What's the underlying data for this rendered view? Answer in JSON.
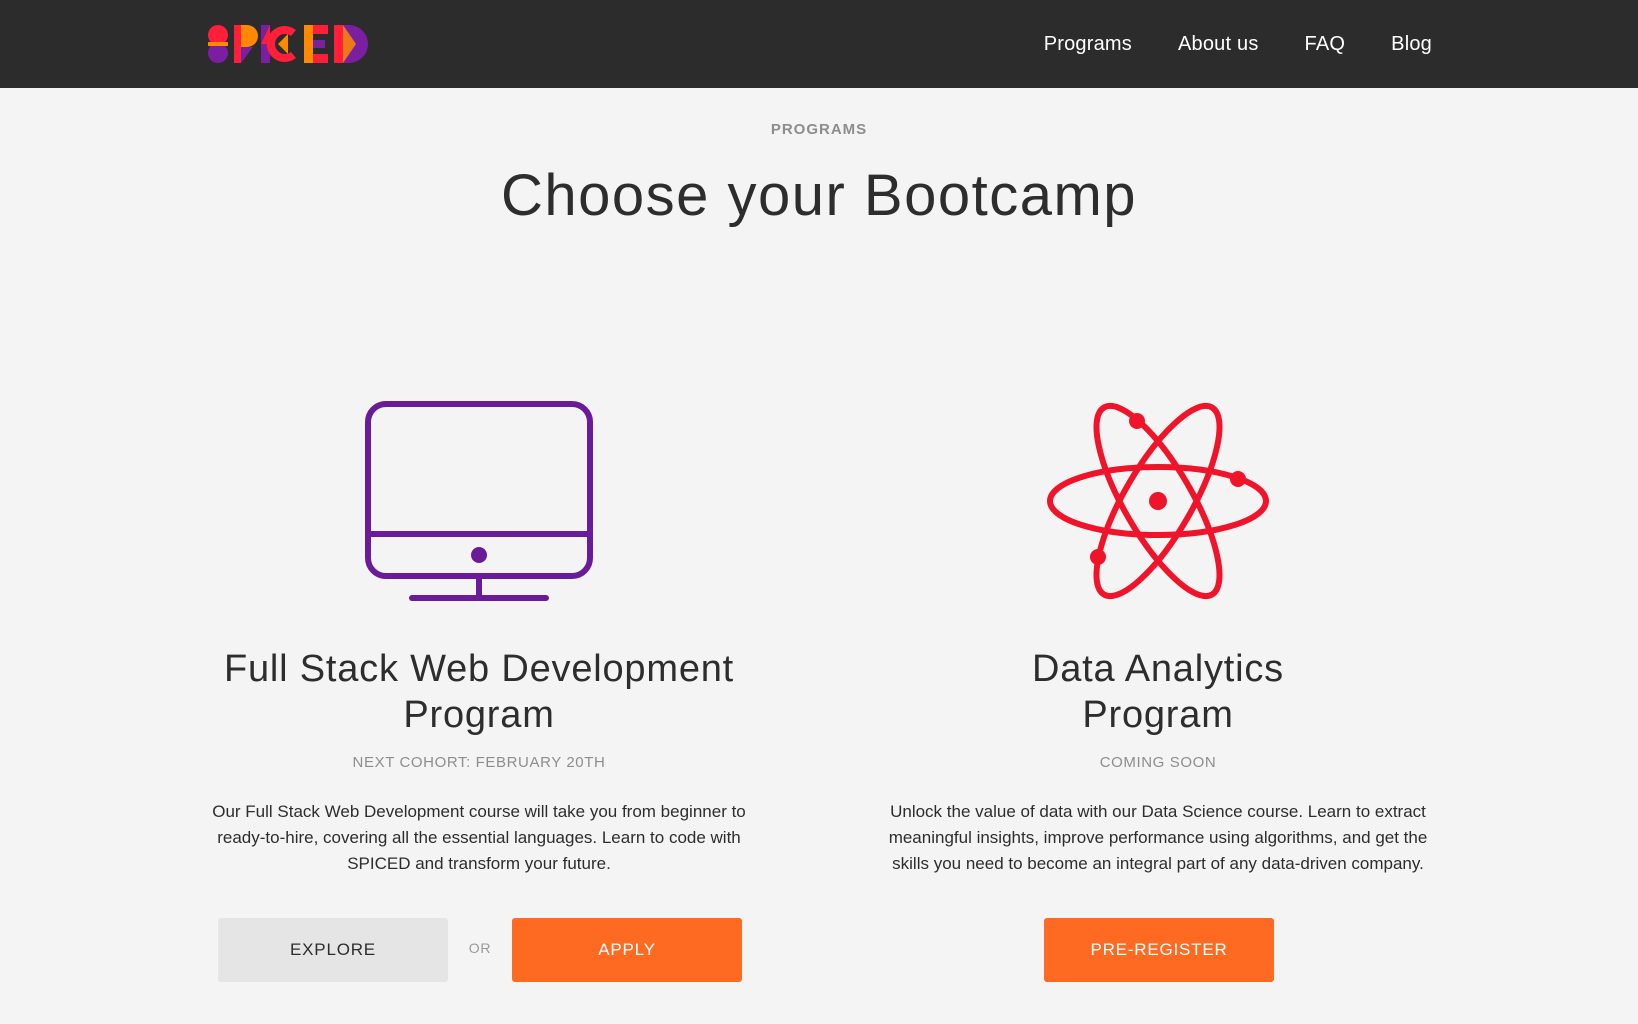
{
  "brand": {
    "name": "SPICED"
  },
  "nav": {
    "items": [
      {
        "label": "Programs"
      },
      {
        "label": "About us"
      },
      {
        "label": "FAQ"
      },
      {
        "label": "Blog"
      }
    ]
  },
  "hero": {
    "eyebrow": "PROGRAMS",
    "title": "Choose your Bootcamp"
  },
  "programs": [
    {
      "icon": "monitor-icon",
      "title_line1": "Full Stack Web Development",
      "title_line2": "Program",
      "subtitle": "NEXT COHORT: FEBRUARY 20TH",
      "description": "Our Full Stack Web Development course will take you from beginner to ready-to-hire, covering all the essential languages. Learn to code with SPICED and transform your future.",
      "buttons": {
        "explore": "EXPLORE",
        "or": "OR",
        "apply": "APPLY"
      }
    },
    {
      "icon": "atom-icon",
      "title_line1": "Data Analytics",
      "title_line2": "Program",
      "subtitle": "COMING SOON",
      "description": "Unlock the value of data with our Data Science course. Learn to extract meaningful insights, improve performance using algorithms, and get the skills you need to become an integral part of any data-driven company.",
      "buttons": {
        "pre_register": "PRE-REGISTER"
      }
    }
  ],
  "colors": {
    "topbar": "#2c2c2c",
    "background": "#f4f4f4",
    "accent_orange": "#ff6a22",
    "monitor_purple": "#6a1b9a",
    "atom_red": "#f0142a"
  }
}
